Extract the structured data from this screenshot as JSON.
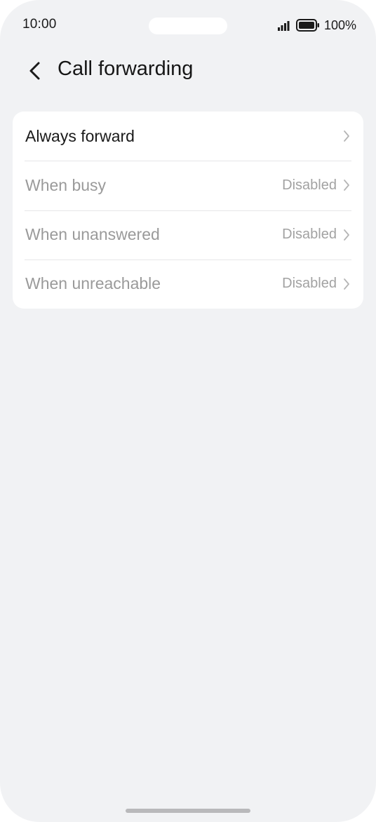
{
  "status_bar": {
    "time": "10:00",
    "battery_percent": "100%",
    "icons": [
      "signal-icon",
      "battery-icon"
    ]
  },
  "header": {
    "back_icon": "chevron-left-icon",
    "title": "Call forwarding"
  },
  "forwarding_options": [
    {
      "label": "Always forward",
      "value": "",
      "enabled_style": true
    },
    {
      "label": "When busy",
      "value": "Disabled",
      "enabled_style": false
    },
    {
      "label": "When unanswered",
      "value": "Disabled",
      "enabled_style": false
    },
    {
      "label": "When unreachable",
      "value": "Disabled",
      "enabled_style": false
    }
  ],
  "colors": {
    "background": "#f1f2f4",
    "card": "#ffffff",
    "primary_text": "#1a1a1a",
    "muted_text": "#9a9a9a"
  }
}
